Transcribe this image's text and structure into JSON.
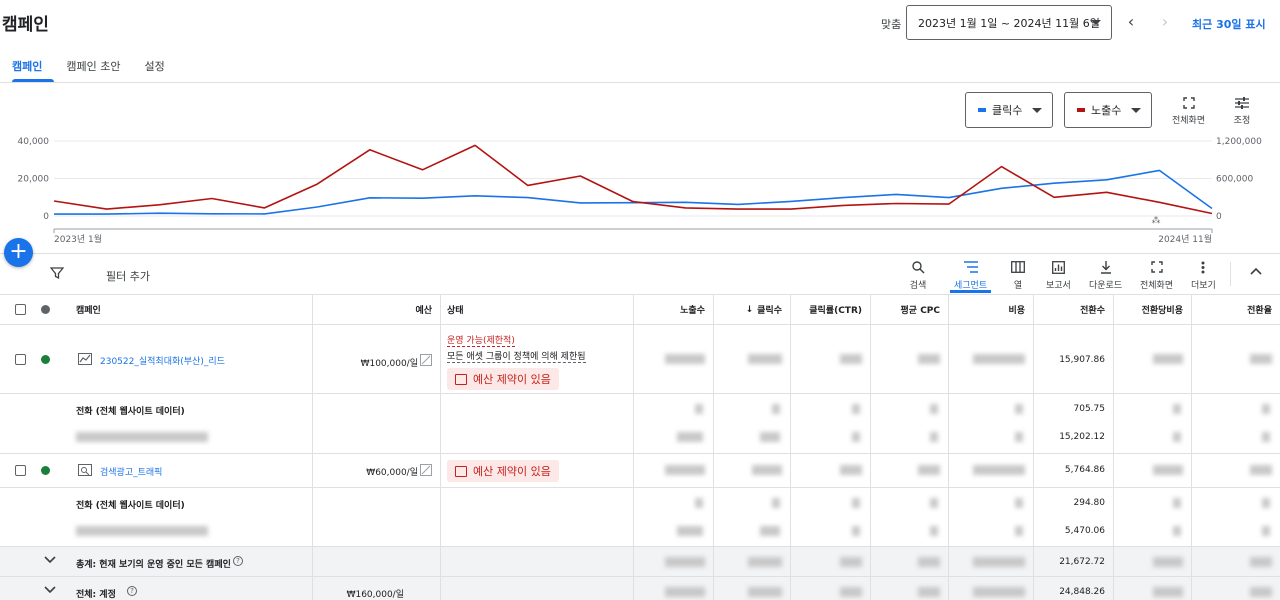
{
  "header": {
    "title": "캠페인",
    "custom_label": "맞춤",
    "date_range": "2023년 1월 1일 ~ 2024년 11월 6일",
    "recent_link": "최근 30일 표시"
  },
  "tabs": [
    {
      "label": "캠페인",
      "active": true
    },
    {
      "label": "캠페인 초안",
      "active": false
    },
    {
      "label": "설정",
      "active": false
    }
  ],
  "chart_controls": {
    "metric1": {
      "label": "클릭수",
      "color": "#1a73e8"
    },
    "metric2": {
      "label": "노출수",
      "color": "#b31412"
    },
    "fullscreen": "전체화면",
    "adjust": "조정"
  },
  "chart_data": {
    "type": "line",
    "x_start_label": "2023년 1월",
    "x_end_label": "2024년 11월",
    "y_left": {
      "ticks": [
        "40,000",
        "20,000",
        "0"
      ],
      "range": [
        0,
        40000
      ]
    },
    "y_right": {
      "ticks": [
        "1,200,000",
        "600,000",
        "0"
      ],
      "range": [
        0,
        1200000
      ]
    },
    "grid": true,
    "series": [
      {
        "name": "클릭수",
        "color": "#1a73e8",
        "axis": "left",
        "values": [
          1000,
          1000,
          1500,
          1200,
          1100,
          4800,
          9700,
          9500,
          10800,
          9800,
          7000,
          7100,
          7300,
          6200,
          7800,
          9800,
          11500,
          9800,
          14800,
          17500,
          19300,
          24300,
          4000
        ]
      },
      {
        "name": "노출수",
        "color": "#b31412",
        "axis": "right",
        "values": [
          240000,
          110000,
          180000,
          280000,
          130000,
          510000,
          1060000,
          740000,
          1130000,
          490000,
          640000,
          230000,
          130000,
          110000,
          110000,
          170000,
          200000,
          190000,
          790000,
          300000,
          380000,
          220000,
          40000
        ]
      }
    ]
  },
  "toolbar": {
    "filter_add": "필터 추가",
    "buttons": [
      {
        "label": "검색",
        "icon": "search-icon"
      },
      {
        "label": "세그먼트",
        "icon": "segment-icon",
        "active": true
      },
      {
        "label": "열",
        "icon": "columns-icon"
      },
      {
        "label": "보고서",
        "icon": "report-icon"
      },
      {
        "label": "다운로드",
        "icon": "download-icon"
      },
      {
        "label": "전체화면",
        "icon": "fullscreen-icon"
      },
      {
        "label": "더보기",
        "icon": "more-icon"
      }
    ]
  },
  "table": {
    "headers": {
      "campaign": "캠페인",
      "budget": "예산",
      "status": "상태",
      "impressions": "노출수",
      "clicks": "클릭수",
      "ctr": "클릭률(CTR)",
      "avg_cpc": "평균 CPC",
      "cost": "비용",
      "conversions": "전환수",
      "cost_per_conv": "전환당비용",
      "conv_rate": "전환율"
    },
    "rows": [
      {
        "name": "230522_실적최대화(부산)_리드",
        "budget": "₩100,000/일",
        "status_line1": "운영 가능(제한적)",
        "status_line2": "모든 애셋 그룹이 정책에 의해 제한됨",
        "badge": "예산 제약이 있음",
        "conversions": "15,907.86"
      },
      {
        "sub_label": "전화 (전체 웹사이트 데이터)",
        "conversions_a": "705.75",
        "conversions_b": "15,202.12"
      },
      {
        "name": "검색광고_트래픽",
        "budget": "₩60,000/일",
        "badge": "예산 제약이 있음",
        "conversions": "5,764.86"
      },
      {
        "sub_label": "전화 (전체 웹사이트 데이터)",
        "conversions_a": "294.80",
        "conversions_b": "5,470.06"
      },
      {
        "summary_label": "총계: 현재 보기의 운영 중인 모든 캠페인",
        "conversions": "21,672.72"
      },
      {
        "summary_label": "전체: 계정",
        "budget": "₩160,000/일",
        "conversions": "24,848.26"
      }
    ]
  }
}
